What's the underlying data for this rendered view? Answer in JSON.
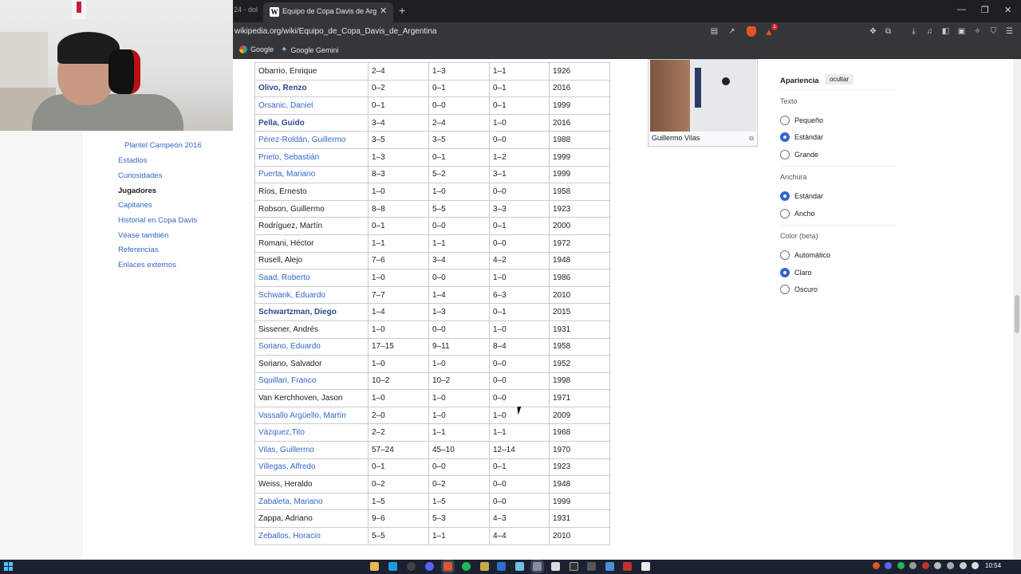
{
  "browser": {
    "prev_tab_title": "24 - dol",
    "active_tab_title": "Equipo de Copa Davis de Argentina",
    "url": "wikipedia.org/wiki/Equipo_de_Copa_Davis_de_Argentina",
    "bookmarks": [
      {
        "label": "Google",
        "icon": "google-icon"
      },
      {
        "label": "Google Gemini",
        "icon": "gemini-icon"
      }
    ]
  },
  "toc": {
    "items": [
      {
        "label": "Plantel Campeón 2016",
        "sub": true,
        "active": false
      },
      {
        "label": "Estadios",
        "sub": false,
        "active": false
      },
      {
        "label": "Curiosidades",
        "sub": false,
        "active": false
      },
      {
        "label": "Jugadores",
        "sub": false,
        "active": true
      },
      {
        "label": "Capitanes",
        "sub": false,
        "active": false
      },
      {
        "label": "Historial en Copa Davis",
        "sub": false,
        "active": false
      },
      {
        "label": "Véase también",
        "sub": false,
        "active": false
      },
      {
        "label": "Referencias",
        "sub": false,
        "active": false
      },
      {
        "label": "Enlaces externos",
        "sub": false,
        "active": false
      }
    ]
  },
  "players": [
    {
      "name": "Obarrio, Enrique",
      "style": "plain",
      "total": "2–4",
      "singles": "1–3",
      "doubles": "1–1",
      "year": "1926"
    },
    {
      "name": "Olivo, Renzo",
      "style": "boldlink",
      "total": "0–2",
      "singles": "0–1",
      "doubles": "0–1",
      "year": "2016"
    },
    {
      "name": "Orsanic, Daniel",
      "style": "link",
      "total": "0–1",
      "singles": "0–0",
      "doubles": "0–1",
      "year": "1999"
    },
    {
      "name": "Pella, Guido",
      "style": "boldlink",
      "total": "3–4",
      "singles": "2–4",
      "doubles": "1–0",
      "year": "2016"
    },
    {
      "name": "Pérez-Roldán, Guillermo",
      "style": "link",
      "total": "3–5",
      "singles": "3–5",
      "doubles": "0–0",
      "year": "1988"
    },
    {
      "name": "Prieto, Sebastián",
      "style": "link",
      "total": "1–3",
      "singles": "0–1",
      "doubles": "1–2",
      "year": "1999"
    },
    {
      "name": "Puerta, Mariano",
      "style": "link",
      "total": "8–3",
      "singles": "5–2",
      "doubles": "3–1",
      "year": "1999"
    },
    {
      "name": "Ríos, Ernesto",
      "style": "plain",
      "total": "1–0",
      "singles": "1–0",
      "doubles": "0–0",
      "year": "1958"
    },
    {
      "name": "Robson, Guillermo",
      "style": "plain",
      "total": "8–8",
      "singles": "5–5",
      "doubles": "3–3",
      "year": "1923"
    },
    {
      "name": "Rodríguez, Martín",
      "style": "plain",
      "total": "0–1",
      "singles": "0–0",
      "doubles": "0–1",
      "year": "2000"
    },
    {
      "name": "Romani, Héctor",
      "style": "plain",
      "total": "1–1",
      "singles": "1–1",
      "doubles": "0–0",
      "year": "1972"
    },
    {
      "name": "Rusell, Alejo",
      "style": "plain",
      "total": "7–6",
      "singles": "3–4",
      "doubles": "4–2",
      "year": "1948"
    },
    {
      "name": "Saad, Roberto",
      "style": "link",
      "total": "1–0",
      "singles": "0–0",
      "doubles": "1–0",
      "year": "1986"
    },
    {
      "name": "Schwank, Eduardo",
      "style": "link",
      "total": "7–7",
      "singles": "1–4",
      "doubles": "6–3",
      "year": "2010"
    },
    {
      "name": "Schwartzman, Diego",
      "style": "boldlink",
      "total": "1–4",
      "singles": "1–3",
      "doubles": "0–1",
      "year": "2015"
    },
    {
      "name": "Sissener, Andrés",
      "style": "plain",
      "total": "1–0",
      "singles": "0–0",
      "doubles": "1–0",
      "year": "1931"
    },
    {
      "name": "Soriano, Eduardo",
      "style": "link",
      "total": "17–15",
      "singles": "9–11",
      "doubles": "8–4",
      "year": "1958"
    },
    {
      "name": "Soriano, Salvador",
      "style": "plain",
      "total": "1–0",
      "singles": "1–0",
      "doubles": "0–0",
      "year": "1952"
    },
    {
      "name": "Squillari, Franco",
      "style": "link",
      "total": "10–2",
      "singles": "10–2",
      "doubles": "0–0",
      "year": "1998"
    },
    {
      "name": "Van Kerchhoven, Jason",
      "style": "plain",
      "total": "1–0",
      "singles": "1–0",
      "doubles": "0–0",
      "year": "1971"
    },
    {
      "name": "Vassallo Argüello, Martín",
      "style": "link",
      "total": "2–0",
      "singles": "1–0",
      "doubles": "1–0",
      "year": "2009"
    },
    {
      "name": "Vázquez,Tito",
      "style": "link",
      "total": "2–2",
      "singles": "1–1",
      "doubles": "1–1",
      "year": "1968"
    },
    {
      "name": "Vilas, Guillermo",
      "style": "link",
      "total": "57–24",
      "singles": "45–10",
      "doubles": "12–14",
      "year": "1970"
    },
    {
      "name": "Villegas, Alfredo",
      "style": "link",
      "total": "0–1",
      "singles": "0–0",
      "doubles": "0–1",
      "year": "1923"
    },
    {
      "name": "Weiss, Heraldo",
      "style": "plain",
      "total": "0–2",
      "singles": "0–2",
      "doubles": "0–0",
      "year": "1948"
    },
    {
      "name": "Zabaleta, Mariano",
      "style": "link",
      "total": "1–5",
      "singles": "1–5",
      "doubles": "0–0",
      "year": "1999"
    },
    {
      "name": "Zappa, Adriano",
      "style": "plain",
      "total": "9–6",
      "singles": "5–3",
      "doubles": "4–3",
      "year": "1931"
    },
    {
      "name": "Zeballos, Horacio",
      "style": "link",
      "total": "5–5",
      "singles": "1–1",
      "doubles": "4–4",
      "year": "2010"
    }
  ],
  "image_caption": "Guillermo Vilas",
  "appearance": {
    "title": "Apariencia",
    "hide_label": "ocultar",
    "groups": [
      {
        "label": "Texto",
        "options": [
          {
            "label": "Pequeño",
            "checked": false
          },
          {
            "label": "Estándar",
            "checked": true
          },
          {
            "label": "Grande",
            "checked": false
          }
        ]
      },
      {
        "label": "Anchura",
        "options": [
          {
            "label": "Estándar",
            "checked": true
          },
          {
            "label": "Ancho",
            "checked": false
          }
        ]
      },
      {
        "label": "Color (beta)",
        "options": [
          {
            "label": "Automático",
            "checked": false
          },
          {
            "label": "Claro",
            "checked": true
          },
          {
            "label": "Oscuro",
            "checked": false
          }
        ]
      }
    ]
  },
  "taskbar": {
    "clock": "10:54",
    "accent": "#4cc2ff"
  }
}
